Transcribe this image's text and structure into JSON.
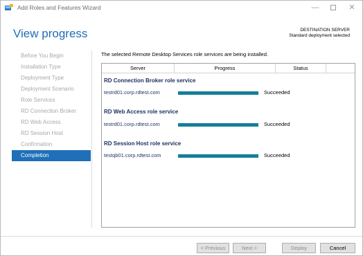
{
  "window": {
    "title": "Add Roles and Features Wizard",
    "icon": "server-manager-icon",
    "controls": {
      "minimize": "—",
      "maximize": "max-icon",
      "close": "✕"
    }
  },
  "header": {
    "page_title": "View progress",
    "destination_label": "DESTINATION SERVER",
    "destination_value": "Standard deployment selected"
  },
  "nav": {
    "items": [
      {
        "label": "Before You Begin",
        "active": false
      },
      {
        "label": "Installation Type",
        "active": false
      },
      {
        "label": "Deployment Type",
        "active": false
      },
      {
        "label": "Deployment Scenario",
        "active": false
      },
      {
        "label": "Role Services",
        "active": false
      },
      {
        "label": "RD Connection Broker",
        "active": false
      },
      {
        "label": "RD Web Access",
        "active": false
      },
      {
        "label": "RD Session Host",
        "active": false
      },
      {
        "label": "Confirmation",
        "active": false
      },
      {
        "label": "Completion",
        "active": true
      }
    ]
  },
  "main": {
    "intro": "The selected Remote Desktop Services role services are being installed.",
    "columns": [
      "Server",
      "Progress",
      "Status"
    ],
    "groups": [
      {
        "title": "RD Connection Broker role service",
        "server": "testrd01.corp.rdtest.com",
        "progress": 1.0,
        "status": "Succeeded"
      },
      {
        "title": "RD Web Access role service",
        "server": "testrd01.corp.rdtest.com",
        "progress": 1.0,
        "status": "Succeeded"
      },
      {
        "title": "RD Session Host role service",
        "server": "testqb01.corp.rdtest.com",
        "progress": 1.0,
        "status": "Succeeded"
      }
    ]
  },
  "footer": {
    "previous": "< Previous",
    "next": "Next >",
    "deploy": "Deploy",
    "cancel": "Cancel"
  },
  "colors": {
    "accent": "#1f6cb7",
    "nav_active": "#1f70b8",
    "progress_fill": "#147f9a",
    "group_title": "#1b2f5e"
  }
}
